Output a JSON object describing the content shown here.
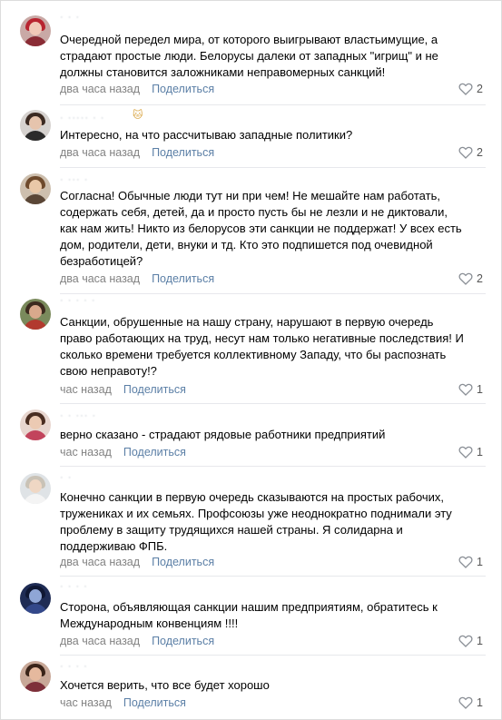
{
  "comments": [
    {
      "author": "· ·  ·",
      "text": "Очередной передел мира, от которого выигрывают властьимущие, а страдают простые люди. Белорусы далеки от западных \"игрищ\" и не должны становится заложниками неправомерных санкций!",
      "time": "два часа назад",
      "share": "Поделиться",
      "likes": "2"
    },
    {
      "author": "· ·····  ·  ·",
      "text": "Интересно, на что рассчитываю западные политики?",
      "time": "два часа назад",
      "share": "Поделиться",
      "likes": "2"
    },
    {
      "author": "· ···  ·",
      "text": "Согласна! Обычные люди тут ни при чем! Не мешайте нам работать, содержать себя, детей, да и просто пусть бы не лезли и не диктовали, как нам жить! Никто из белорусов эти санкции не поддержат! У всех есть дом, родители, дети, внуки и тд. Кто это подпишется под очевидной безработицей?",
      "time": "два часа назад",
      "share": "Поделиться",
      "likes": "2"
    },
    {
      "author": "· ·   · ·  ·",
      "text": "Санкции, обрушенные на нашу страну, нарушают в первую очередь право работающих на труд, несут нам только негативные последствия! И сколько времени требуется коллективному Западу, что бы распознать свою неправоту!?",
      "time": "час назад",
      "share": "Поделиться",
      "likes": "1"
    },
    {
      "author": "· · ··· ·",
      "text": "верно сказано - страдают рядовые работники предприятий",
      "time": "час назад",
      "share": "Поделиться",
      "likes": "1"
    },
    {
      "author": "·  ·",
      "text": "Конечно санкции в первую очередь сказываются на простых рабочих, тружениках и их семьях. Профсоюзы уже неоднократно поднимали эту проблему в защиту трудящихся нашей страны. Я солидарна и поддерживаю ФПБ.",
      "time": "два часа назад",
      "share": "Поделиться",
      "likes": "1"
    },
    {
      "author": "· ·  ·  ·",
      "text": "Сторона, объявляющая санкции нашим предприятиям, обратитесь к Международным конвенциям !!!!",
      "time": "два часа назад",
      "share": "Поделиться",
      "likes": "1"
    },
    {
      "author": "· ·  · ·",
      "text": "Хочется верить, что все будет хорошо",
      "time": "час назад",
      "share": "Поделиться",
      "likes": "1"
    }
  ],
  "colors": {
    "link": "#5b7fa6",
    "muted": "#828282",
    "separator": "#e7e8ec"
  },
  "icons": {
    "like": "heart-outline-icon",
    "badge": "cat-emoji-icon"
  }
}
